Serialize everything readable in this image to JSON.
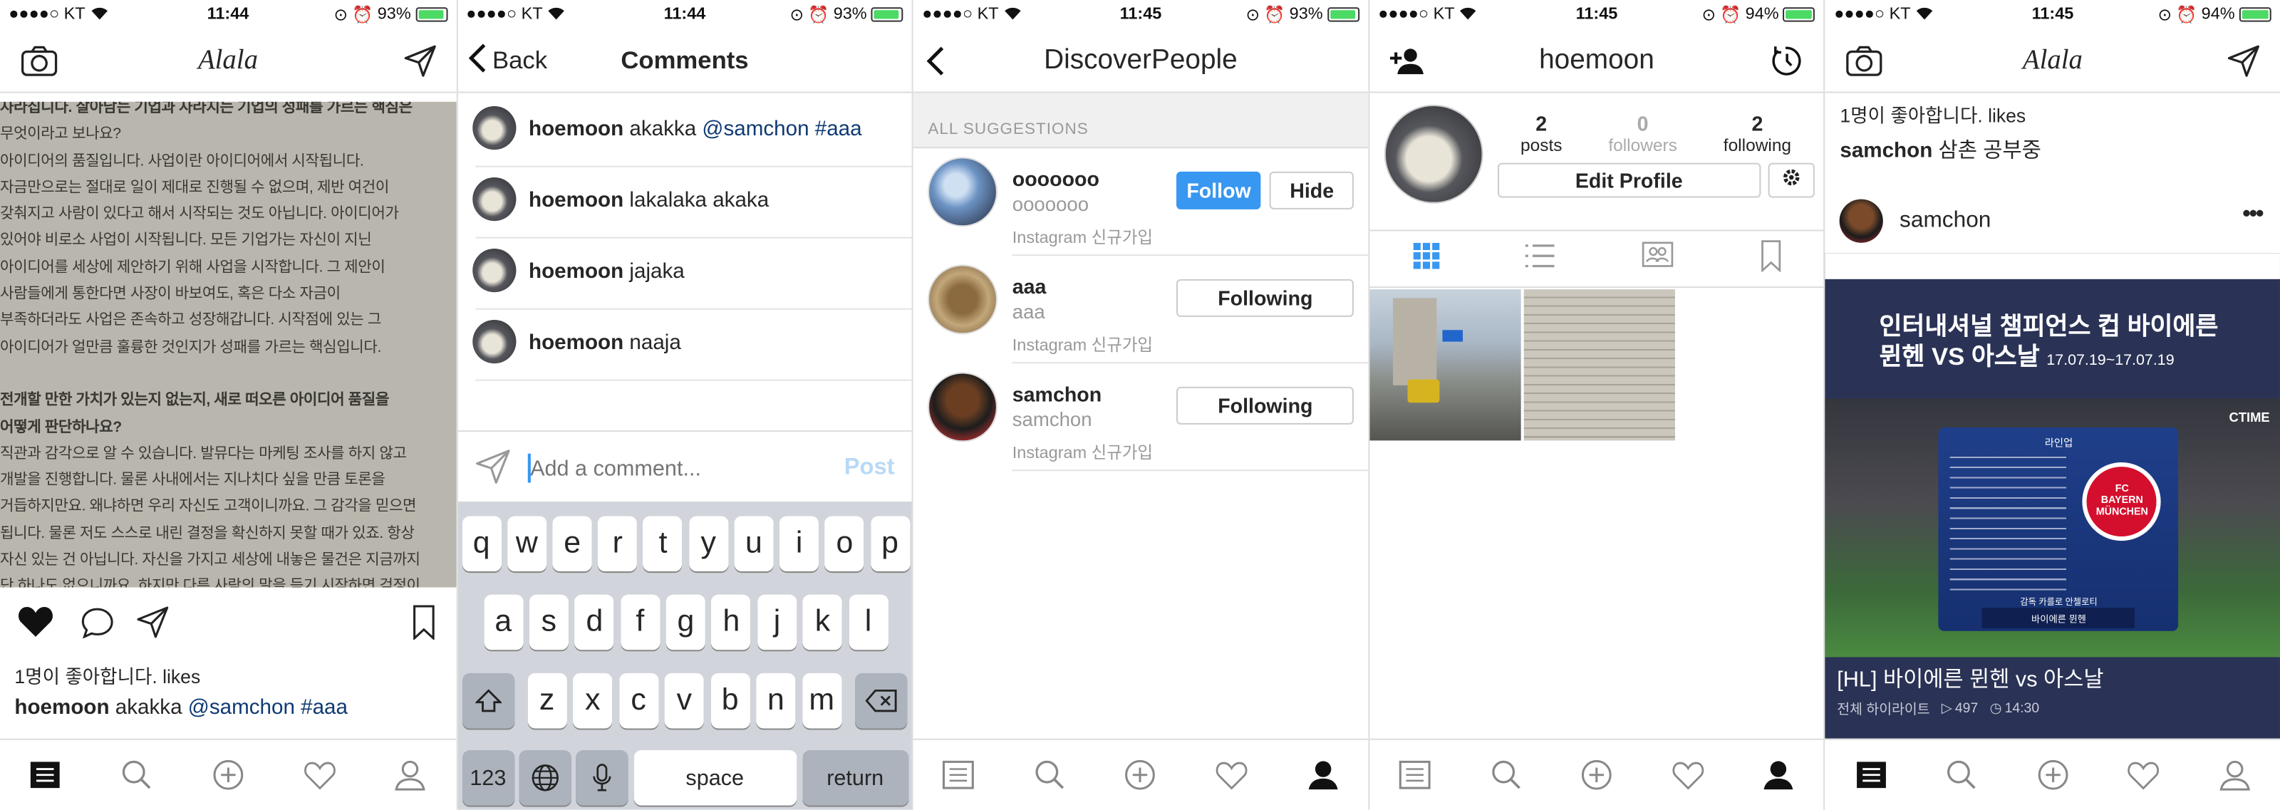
{
  "screens": {
    "feed": {
      "status": {
        "carrier": "●●●●○ KT",
        "time": "11:44",
        "battery": "93%"
      },
      "title": "Alala",
      "photo_text": [
        "사라집니다. 살아남는 기업과 사라지는 기업의 성패를 가르는 핵심은",
        "무엇이라고 보나요?",
        "아이디어의 품질입니다. 사업이란 아이디어에서 시작됩니다.",
        "자금만으로는 절대로 일이 제대로 진행될 수 없으며, 제반 여건이",
        "갖춰지고 사람이 있다고 해서 시작되는 것도 아닙니다. 아이디어가",
        "있어야 비로소 사업이 시작됩니다. 모든 기업가는 자신이 지닌",
        "아이디어를 세상에 제안하기 위해 사업을 시작합니다. 그 제안이",
        "사람들에게 통한다면 사장이 바보여도, 혹은 다소 자금이",
        "부족하더라도 사업은 존속하고 성장해갑니다. 시작점에 있는 그",
        "아이디어가 얼만큼 훌륭한 것인지가 성패를 가르는 핵심입니다.",
        "",
        "전개할 만한 가치가 있는지 없는지, 새로 떠오른 아이디어 품질을",
        "어떻게 판단하나요?",
        "직관과 감각으로 알 수 있습니다. 발뮤다는 마케팅 조사를 하지 않고",
        "개발을 진행합니다. 물론 사내에서는 지나치다 싶을 만큼 토론을",
        "거듭하지만요. 왜냐하면 우리 자신도 고객이니까요. 그 감각을 믿으면",
        "됩니다. 물론 저도 스스로 내린 결정을 확신하지 못할 때가 있죠. 항상",
        "자신 있는 건 아닙니다. 자신을 가지고 세상에 내놓은 물건은 지금까지",
        "단 하나도 없으니까요. 하지만 다른 사람의 말을 듣기 시작하면 걱정이"
      ],
      "likes": "1명이 좋아합니다. likes",
      "caption_user": "hoemoon",
      "caption_text": "akakka",
      "caption_tags": "@samchon #aaa"
    },
    "comments": {
      "status": {
        "carrier": "●●●●○ KT",
        "time": "11:44",
        "battery": "93%"
      },
      "back_label": "Back",
      "title": "Comments",
      "items": [
        {
          "user": "hoemoon",
          "text": "akakka",
          "tags": "@samchon #aaa"
        },
        {
          "user": "hoemoon",
          "text": "lakalaka akaka",
          "tags": ""
        },
        {
          "user": "hoemoon",
          "text": "jajaka",
          "tags": ""
        },
        {
          "user": "hoemoon",
          "text": "naaja",
          "tags": ""
        }
      ],
      "input_placeholder": "Add a comment...",
      "post_label": "Post",
      "keyboard": {
        "row1": [
          "q",
          "w",
          "e",
          "r",
          "t",
          "y",
          "u",
          "i",
          "o",
          "p"
        ],
        "row2": [
          "a",
          "s",
          "d",
          "f",
          "g",
          "h",
          "j",
          "k",
          "l"
        ],
        "row3": [
          "z",
          "x",
          "c",
          "v",
          "b",
          "n",
          "m"
        ],
        "num": "123",
        "space": "space",
        "return": "return"
      }
    },
    "discover": {
      "status": {
        "carrier": "●●●●○ KT",
        "time": "11:45",
        "battery": "93%"
      },
      "title": "DiscoverPeople",
      "section": "ALL SUGGESTIONS",
      "items": [
        {
          "name": "ooooooo",
          "sub": "ooooooo",
          "note": "Instagram 신규가입",
          "action": "Follow",
          "secondary": "Hide"
        },
        {
          "name": "aaa",
          "sub": "aaa",
          "note": "Instagram 신규가입",
          "action": "Following",
          "secondary": ""
        },
        {
          "name": "samchon",
          "sub": "samchon",
          "note": "Instagram 신규가입",
          "action": "Following",
          "secondary": ""
        }
      ]
    },
    "profile": {
      "status": {
        "carrier": "●●●●○ KT",
        "time": "11:45",
        "battery": "94%"
      },
      "title": "hoemoon",
      "stats": [
        {
          "value": "2",
          "label": "posts"
        },
        {
          "value": "0",
          "label": "followers"
        },
        {
          "value": "2",
          "label": "following"
        }
      ],
      "edit_label": "Edit Profile"
    },
    "feed2": {
      "status": {
        "carrier": "●●●●○ KT",
        "time": "11:45",
        "battery": "94%"
      },
      "title": "Alala",
      "likes": "1명이 좋아합니다. likes",
      "caption_user": "samchon",
      "caption_text": "삼촌 공부중",
      "post_user": "samchon",
      "banner_title1": "인터내셔널 챔피언스 컵 바이에른",
      "banner_title2": "뮌헨 VS 아스날",
      "banner_date": "17.07.19~17.07.19",
      "tv_brand": "CTIME",
      "lineup_title": "라인업",
      "lineup_footer": "바이에른 뮌헨",
      "lineup_coach": "감독 카를로 안첼로티",
      "club_badge": "FC BAYERN MÜNCHEN",
      "video_title": "[HL] 바이에른 뮌헨 vs 아스날",
      "video_meta": "전체 하이라이트",
      "video_views": "497",
      "video_time": "14:30"
    }
  },
  "colors": {
    "accent": "#3897f0",
    "link": "#0f3a73",
    "keyboard_bg": "#d1d5db",
    "banner": "#2a3255"
  }
}
